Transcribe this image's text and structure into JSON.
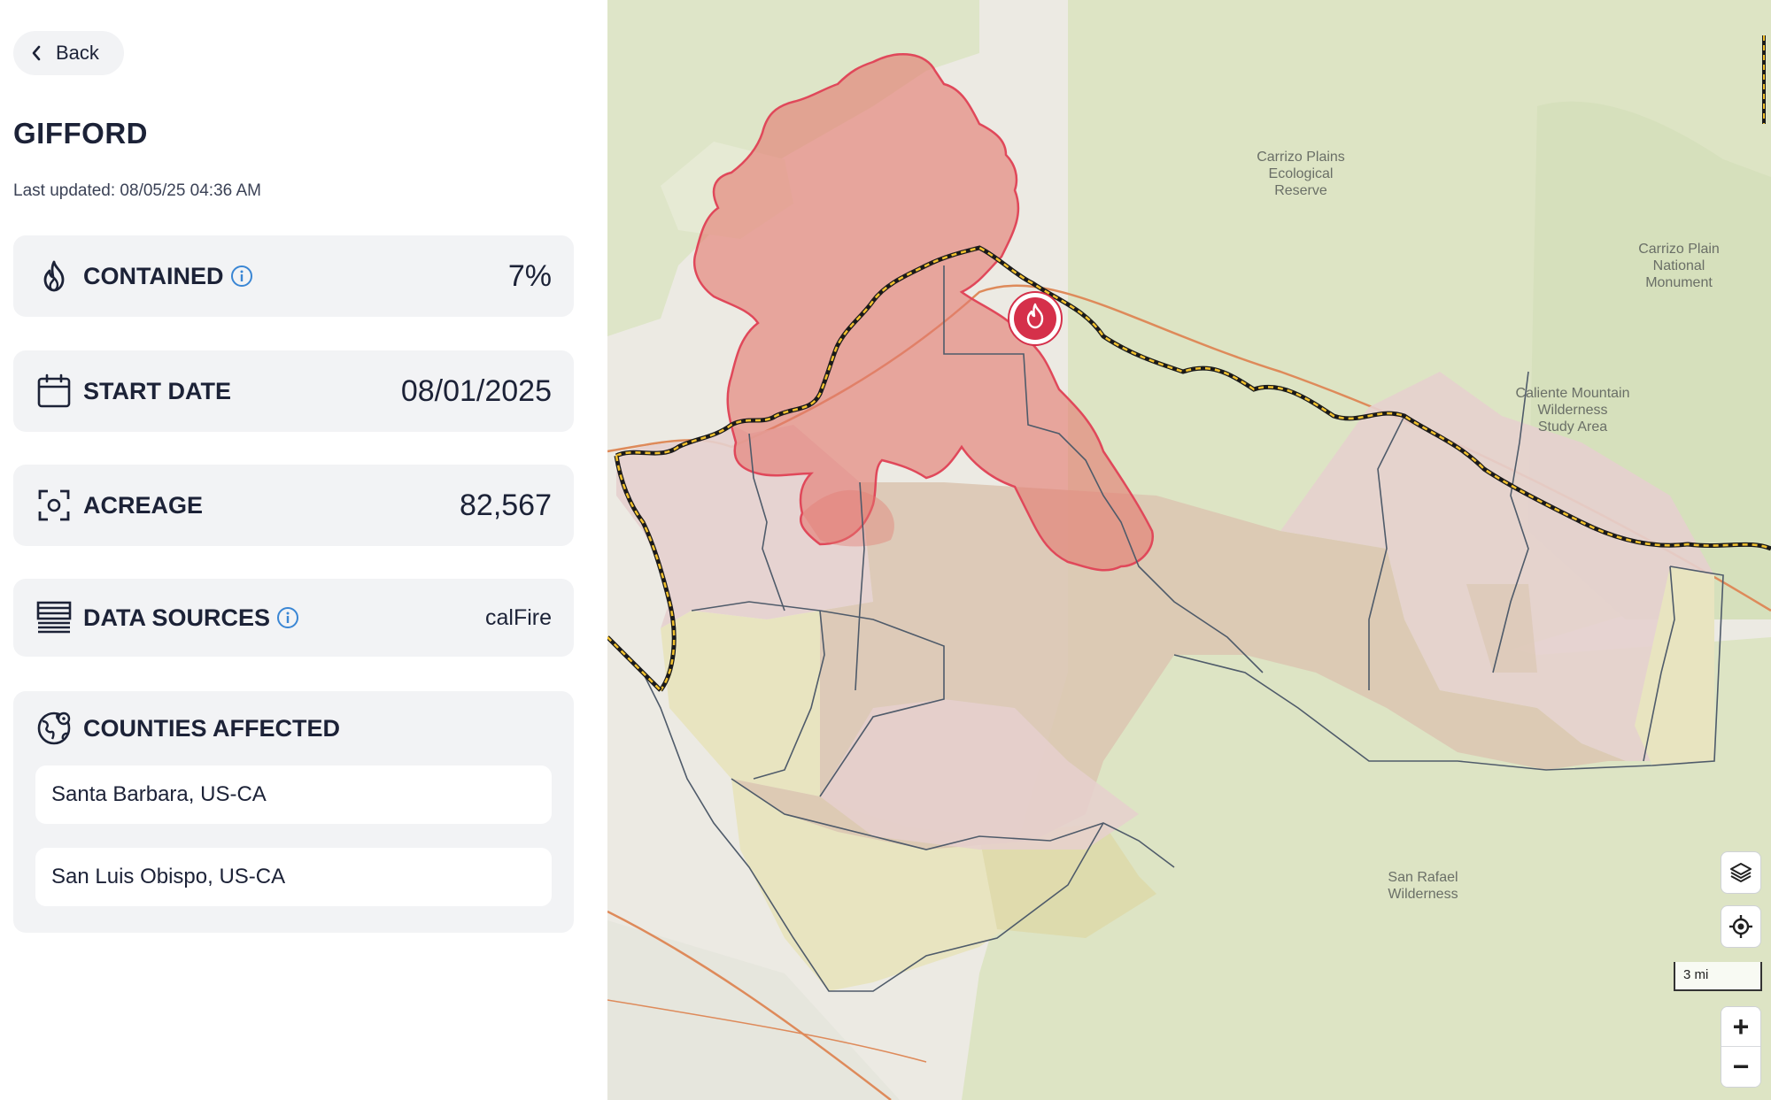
{
  "back_label": "Back",
  "fire": {
    "name": "GIFFORD",
    "last_updated": "Last updated: 08/05/25 04:36 AM"
  },
  "stats": {
    "contained": {
      "label": "CONTAINED",
      "value": "7%"
    },
    "start_date": {
      "label": "START DATE",
      "value": "08/01/2025"
    },
    "acreage": {
      "label": "ACREAGE",
      "value": "82,567"
    },
    "data_sources": {
      "label": "DATA SOURCES",
      "value": "calFire"
    }
  },
  "counties": {
    "label": "COUNTIES AFFECTED",
    "items": [
      "Santa Barbara, US-CA",
      "San Luis Obispo, US-CA"
    ]
  },
  "map": {
    "labels": {
      "carrizo_plains_reserve": [
        "Carrizo Plains",
        "Ecological",
        "Reserve"
      ],
      "carrizo_plain_monument": [
        "Carrizo Plain",
        "National",
        "Monument"
      ],
      "caliente": [
        "Caliente Mountain",
        "Wilderness",
        "Study Area"
      ],
      "san_rafael": [
        "San Rafael",
        "Wilderness"
      ]
    },
    "scale_label": "3 mi",
    "zoom_in": "+",
    "zoom_out": "−"
  },
  "colors": {
    "fire_red": "#d5304a",
    "accent_blue": "#3a86d4",
    "text_dark": "#1c2237"
  },
  "icons": {
    "back": "chevron-left-icon",
    "contained": "flame-icon",
    "start_date": "calendar-icon",
    "acreage": "focus-icon",
    "data_sources": "database-icon",
    "info": "info-icon",
    "counties": "globe-icon",
    "layers": "layers-icon",
    "locate": "locate-icon"
  }
}
